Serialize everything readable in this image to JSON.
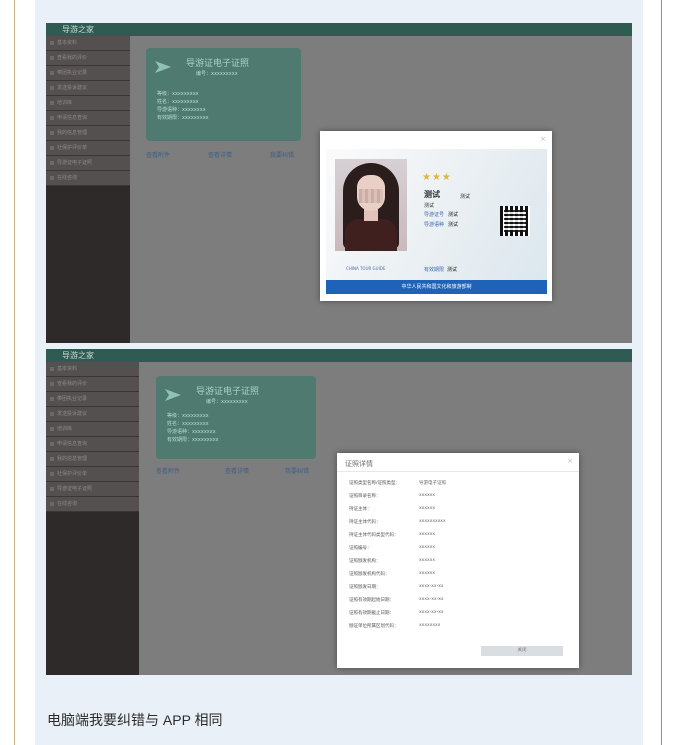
{
  "colors": {
    "teal_bar": "#2f5b52",
    "card_blue": "#1e63b8",
    "star": "#e0b63d"
  },
  "shot1": {
    "brand": "导游之家",
    "menu": [
      "基本资料",
      "查看我的评价",
      "带团执业记录",
      "发送投诉建议",
      "培训库",
      "申请信息查询",
      "我的信息管理",
      "社保护评价单",
      "导游证电子证照",
      "在线咨询"
    ],
    "card": {
      "title": "导游证电子证照",
      "no_label": "编号：",
      "no_value": "xxxxxxxxx",
      "fields": [
        "等级：xxxxxxxxx",
        "姓名：xxxxxxxxx",
        "导游语种：xxxxxxxx",
        "有效期限：xxxxxxxxx"
      ]
    },
    "links": [
      "查看附件",
      "查看详情",
      "我要纠错"
    ],
    "modal": {
      "close": "×",
      "stars": "★★★",
      "name": "测试",
      "name_extra": "测试",
      "gender": "测试",
      "rows": [
        {
          "label": "导游证号",
          "value": "测试"
        },
        {
          "label": "导游语种",
          "value": "测试"
        }
      ],
      "guide_en": "CHINA TOUR GUIDE",
      "expire_label": "有效期限",
      "expire_value": "测试",
      "footer": "中华人民共和国文化和旅游部制"
    }
  },
  "shot2": {
    "brand": "导游之家",
    "menu": [
      "基本资料",
      "查看我的评价",
      "带团执业记录",
      "发送投诉建议",
      "培训库",
      "申请信息查询",
      "我的信息管理",
      "社保护评价单",
      "导游证电子证照",
      "在线咨询"
    ],
    "card": {
      "title": "导游证电子证照",
      "no_label": "编号：",
      "no_value": "xxxxxxxxx",
      "fields": [
        "等级：xxxxxxxxx",
        "姓名：xxxxxxxxx",
        "导游语种：xxxxxxxx",
        "有效期限：xxxxxxxxx"
      ]
    },
    "links": [
      "查看附件",
      "查看详情",
      "我要纠错"
    ],
    "modal": {
      "title": "证照详情",
      "close": "×",
      "rows": [
        {
          "k": "证照类型名称/证照类型：",
          "v": "导游电子证照"
        },
        {
          "k": "证照目录名称：",
          "v": "xxxxxx"
        },
        {
          "k": "持证主体：",
          "v": "xxxxxx"
        },
        {
          "k": "持证主体代码：",
          "v": "xxxxxxxxxx"
        },
        {
          "k": "持证主体代码类型代码：",
          "v": "xxxxxx"
        },
        {
          "k": "证照编号：",
          "v": "xxxxxx"
        },
        {
          "k": "证照颁发机构：",
          "v": "xxxxxx"
        },
        {
          "k": "证照颁发机构代码：",
          "v": "xxxxxx"
        },
        {
          "k": "证照颁发日期：",
          "v": "xxxx-xx-xx"
        },
        {
          "k": "证照有效期起始日期：",
          "v": "xxxx-xx-xx"
        },
        {
          "k": "证照有效期截止日期：",
          "v": "xxxx-xx-xx"
        },
        {
          "k": "颁证单位所属区划代码：",
          "v": "xxxxxxxx"
        }
      ],
      "close_button": "关闭"
    }
  },
  "caption": "电脑端我要纠错与 APP 相同"
}
